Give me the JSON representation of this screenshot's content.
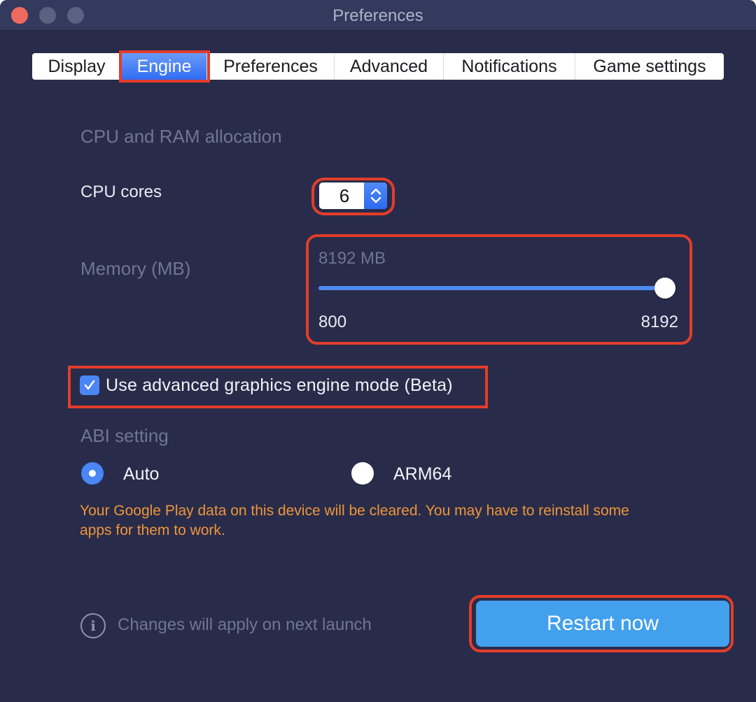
{
  "window": {
    "title": "Preferences",
    "traffic_lights": [
      "close",
      "minimize",
      "maximize"
    ]
  },
  "tabs": [
    {
      "label": "Display",
      "active": false
    },
    {
      "label": "Engine",
      "active": true
    },
    {
      "label": "Preferences",
      "active": false
    },
    {
      "label": "Advanced",
      "active": false
    },
    {
      "label": "Notifications",
      "active": false
    },
    {
      "label": "Game settings",
      "active": false
    }
  ],
  "engine": {
    "section_title": "CPU and RAM allocation",
    "cpu": {
      "label": "CPU cores",
      "value": "6",
      "stepper_icon": "chevron-up-down-icon"
    },
    "memory": {
      "label": "Memory (MB)",
      "current_value_text": "8192 MB",
      "min_label": "800",
      "max_label": "8192",
      "min": 800,
      "max": 8192,
      "value": 8192
    },
    "advanced_graphics": {
      "label": "Use advanced graphics engine mode (Beta)",
      "checked": true
    },
    "abi": {
      "title": "ABI setting",
      "options": [
        {
          "label": "Auto",
          "selected": true
        },
        {
          "label": "ARM64",
          "selected": false
        }
      ]
    },
    "warning": "Your Google Play data on this device will be cleared. You may have to reinstall some apps for them to work."
  },
  "footer": {
    "info_icon": "info-icon",
    "info_text": "Changes will apply on next launch",
    "restart_label": "Restart now"
  },
  "colors": {
    "background": "#282c4a",
    "titlebar": "#333a5e",
    "accent_blue": "#4a86f5",
    "button_blue": "#42a0ec",
    "warning_orange": "#f0943a",
    "highlight_red": "#e33d2a",
    "muted_text": "#6f7594"
  }
}
